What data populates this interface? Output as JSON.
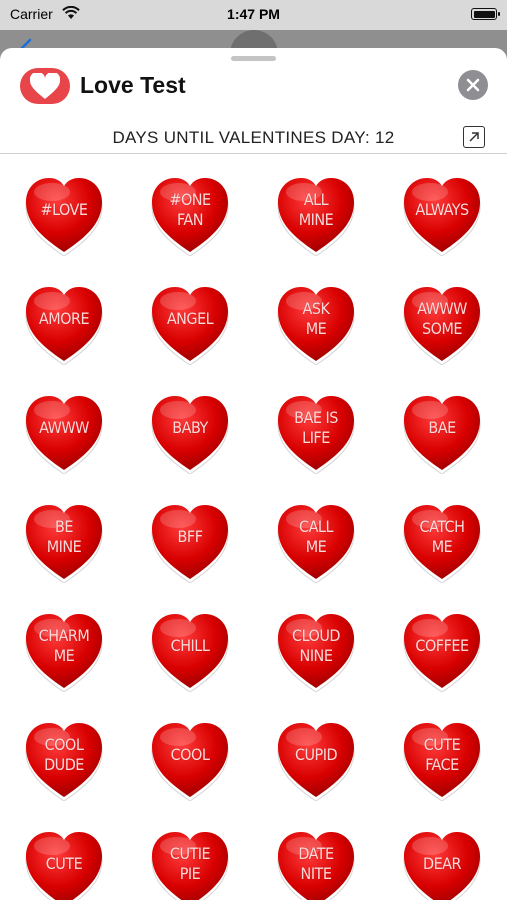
{
  "status_bar": {
    "carrier": "Carrier",
    "time": "1:47 PM"
  },
  "header": {
    "title": "Love Test"
  },
  "banner": {
    "days_text": "DAYS UNTIL VALENTINES DAY: 12"
  },
  "colors": {
    "accent": "#e8454a",
    "heart": "#d40000",
    "close_button": "#8e8e93"
  },
  "stickers": [
    "#LOVE",
    "#ONE\nFAN",
    "ALL\nMINE",
    "ALWAYS",
    "AMORE",
    "ANGEL",
    "ASK\nME",
    "AWWW\nSOME",
    "AWWW",
    "BABY",
    "BAE IS\nLIFE",
    "BAE",
    "BE\nMINE",
    "BFF",
    "CALL\nME",
    "CATCH\nME",
    "CHARM\nME",
    "CHILL",
    "CLOUD\nNINE",
    "COFFEE",
    "COOL\nDUDE",
    "COOL",
    "CUPID",
    "CUTE\nFACE",
    "CUTE",
    "CUTIE\nPIE",
    "DATE\nNITE",
    "DEAR"
  ]
}
